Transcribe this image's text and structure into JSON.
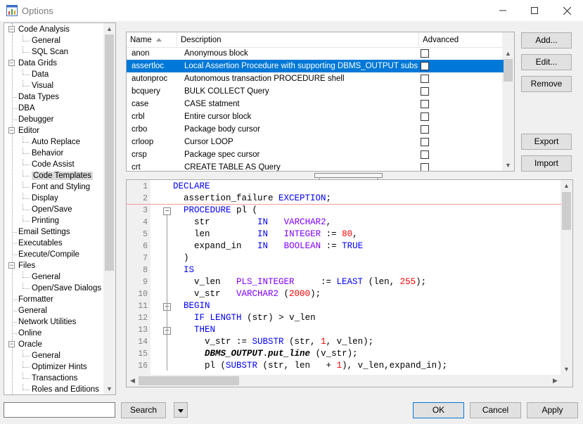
{
  "window": {
    "title": "Options"
  },
  "tree": {
    "items": [
      {
        "label": "Code Analysis",
        "level": 0,
        "expander": "−"
      },
      {
        "label": "General",
        "level": 1
      },
      {
        "label": "SQL Scan",
        "level": 1
      },
      {
        "label": "Data Grids",
        "level": 0,
        "expander": "−"
      },
      {
        "label": "Data",
        "level": 1
      },
      {
        "label": "Visual",
        "level": 1
      },
      {
        "label": "Data Types",
        "level": 0
      },
      {
        "label": "DBA",
        "level": 0
      },
      {
        "label": "Debugger",
        "level": 0
      },
      {
        "label": "Editor",
        "level": 0,
        "expander": "−"
      },
      {
        "label": "Auto Replace",
        "level": 1
      },
      {
        "label": "Behavior",
        "level": 1
      },
      {
        "label": "Code Assist",
        "level": 1
      },
      {
        "label": "Code Templates",
        "level": 1,
        "selected": true
      },
      {
        "label": "Font and Styling",
        "level": 1
      },
      {
        "label": "Display",
        "level": 1
      },
      {
        "label": "Open/Save",
        "level": 1
      },
      {
        "label": "Printing",
        "level": 1
      },
      {
        "label": "Email Settings",
        "level": 0
      },
      {
        "label": "Executables",
        "level": 0
      },
      {
        "label": "Execute/Compile",
        "level": 0
      },
      {
        "label": "Files",
        "level": 0,
        "expander": "−"
      },
      {
        "label": "General",
        "level": 1
      },
      {
        "label": "Open/Save Dialogs",
        "level": 1
      },
      {
        "label": "Formatter",
        "level": 0
      },
      {
        "label": "General",
        "level": 0
      },
      {
        "label": "Network Utilities",
        "level": 0
      },
      {
        "label": "Online",
        "level": 0
      },
      {
        "label": "Oracle",
        "level": 0,
        "expander": "−"
      },
      {
        "label": "General",
        "level": 1
      },
      {
        "label": "Optimizer Hints",
        "level": 1
      },
      {
        "label": "Transactions",
        "level": 1
      },
      {
        "label": "Roles and Editions",
        "level": 1
      }
    ]
  },
  "templates": {
    "columns": [
      "Name",
      "Description",
      "Advanced"
    ],
    "rows": [
      {
        "name": "anon",
        "description": "Anonymous block",
        "advanced": false
      },
      {
        "name": "assertloc",
        "description": "Local Assertion Procedure with supporting DBMS_OUTPUT substitute",
        "advanced": false,
        "selected": true
      },
      {
        "name": "autonproc",
        "description": "Autonomous transaction PROCEDURE shell",
        "advanced": false
      },
      {
        "name": "bcquery",
        "description": "BULK COLLECT Query",
        "advanced": false
      },
      {
        "name": "case",
        "description": "CASE statment",
        "advanced": false
      },
      {
        "name": "crbl",
        "description": "Entire cursor block",
        "advanced": false
      },
      {
        "name": "crbo",
        "description": "Package body cursor",
        "advanced": false
      },
      {
        "name": "crloop",
        "description": "Cursor LOOP",
        "advanced": false
      },
      {
        "name": "crsp",
        "description": "Package spec cursor",
        "advanced": false
      },
      {
        "name": "crt",
        "description": "CREATE TABLE AS Query",
        "advanced": false
      }
    ]
  },
  "buttons": {
    "add": "Add...",
    "edit": "Edit...",
    "remove": "Remove",
    "export": "Export",
    "import": "Import",
    "search": "Search",
    "ok": "OK",
    "cancel": "Cancel",
    "apply": "Apply"
  },
  "search": {
    "value": ""
  },
  "editor": {
    "lines": [
      {
        "n": "1",
        "html": "<span class=\"kw\">DECLARE</span>"
      },
      {
        "n": "2",
        "html": "  assertion_failure <span class=\"kw\">EXCEPTION</span>;"
      },
      {
        "n": "3",
        "html": "  <span class=\"kw\">PROCEDURE</span> pl (",
        "fold": true
      },
      {
        "n": "4",
        "html": "    str         <span class=\"kw\">IN</span>   <span class=\"dt\">VARCHAR2</span>,"
      },
      {
        "n": "5",
        "html": "    len         <span class=\"kw\">IN</span>   <span class=\"dt\">INTEGER</span> := <span class=\"num\">80</span>,"
      },
      {
        "n": "6",
        "html": "    expand_in   <span class=\"kw\">IN</span>   <span class=\"dt\">BOOLEAN</span> := <span class=\"kw\">TRUE</span>"
      },
      {
        "n": "7",
        "html": "  )"
      },
      {
        "n": "8",
        "html": "  <span class=\"kw\">IS</span>"
      },
      {
        "n": "9",
        "html": "    v_len   <span class=\"dt\">PLS_INTEGER</span>     := <span class=\"kw\">LEAST</span> (len, <span class=\"num\">255</span>);"
      },
      {
        "n": "10",
        "html": "    v_str   <span class=\"dt\">VARCHAR2</span> (<span class=\"num\">2000</span>);"
      },
      {
        "n": "11",
        "html": "  <span class=\"kw\">BEGIN</span>",
        "fold": true
      },
      {
        "n": "12",
        "html": "    <span class=\"kw\">IF</span> <span class=\"kw\">LENGTH</span> (str) &gt; v_len"
      },
      {
        "n": "13",
        "html": "    <span class=\"kw\">THEN</span>",
        "fold": true
      },
      {
        "n": "14",
        "html": "      v_str := <span class=\"kw\">SUBSTR</span> (str, <span class=\"num\">1</span>, v_len);"
      },
      {
        "n": "15",
        "html": "      <span class=\"pkg\">DBMS_OUTPUT</span>.<span class=\"pkg\">put_line</span> (v_str);"
      },
      {
        "n": "16",
        "html": "      pl (<span class=\"kw\">SUBSTR</span> (str, len   + <span class=\"num\">1</span>), v_len,expand_in);"
      }
    ]
  },
  "colors": {
    "selection": "#0078d7",
    "keyword": "#0000ff",
    "datatype": "#8000ff",
    "number": "#ff0000",
    "caret_line": "#ff9999"
  },
  "icons": {
    "app": "options-window-icon",
    "minimize": "minimize-icon",
    "maximize": "maximize-icon",
    "close": "close-icon",
    "dropdown": "chevron-down-icon"
  }
}
